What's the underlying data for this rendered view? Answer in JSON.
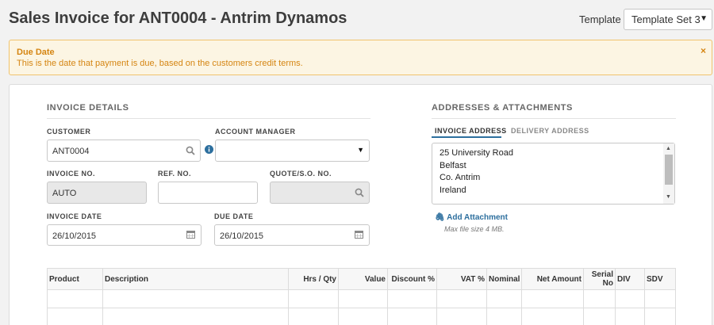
{
  "header": {
    "title": "Sales Invoice  for ANT0004 - Antrim Dynamos",
    "template_label": "Template",
    "template_value": "Template Set 3"
  },
  "alert": {
    "title": "Due Date",
    "text": "This is the date that payment is due, based on the customers credit terms.",
    "close": "×"
  },
  "invoice_details": {
    "heading": "INVOICE DETAILS",
    "customer_label": "CUSTOMER",
    "customer_value": "ANT0004",
    "account_manager_label": "ACCOUNT MANAGER",
    "account_manager_value": "",
    "invoice_no_label": "INVOICE NO.",
    "invoice_no_value": "AUTO",
    "ref_no_label": "REF. NO.",
    "ref_no_value": "",
    "quote_label": "QUOTE/S.O. NO.",
    "quote_value": "",
    "invoice_date_label": "INVOICE DATE",
    "invoice_date_value": "26/10/2015",
    "due_date_label": "DUE DATE",
    "due_date_value": "26/10/2015"
  },
  "addresses": {
    "heading": "ADDRESSES & ATTACHMENTS",
    "tab_invoice": "INVOICE ADDRESS",
    "tab_delivery": "DELIVERY ADDRESS",
    "lines": [
      "25 University Road",
      "Belfast",
      "Co. Antrim",
      "Ireland"
    ],
    "add_attachment": "Add Attachment",
    "max_size": "Max file size 4 MB."
  },
  "table": {
    "columns": [
      "Product",
      "Description",
      "Hrs / Qty",
      "Value",
      "Discount %",
      "VAT %",
      "Nominal",
      "Net Amount",
      "Serial No",
      "DIV",
      "SDV"
    ]
  },
  "colors": {
    "accent": "#2d6f9e",
    "alert_text": "#d58512",
    "alert_bg": "#fcf5e3",
    "info_icon": "#2d6f9e"
  }
}
